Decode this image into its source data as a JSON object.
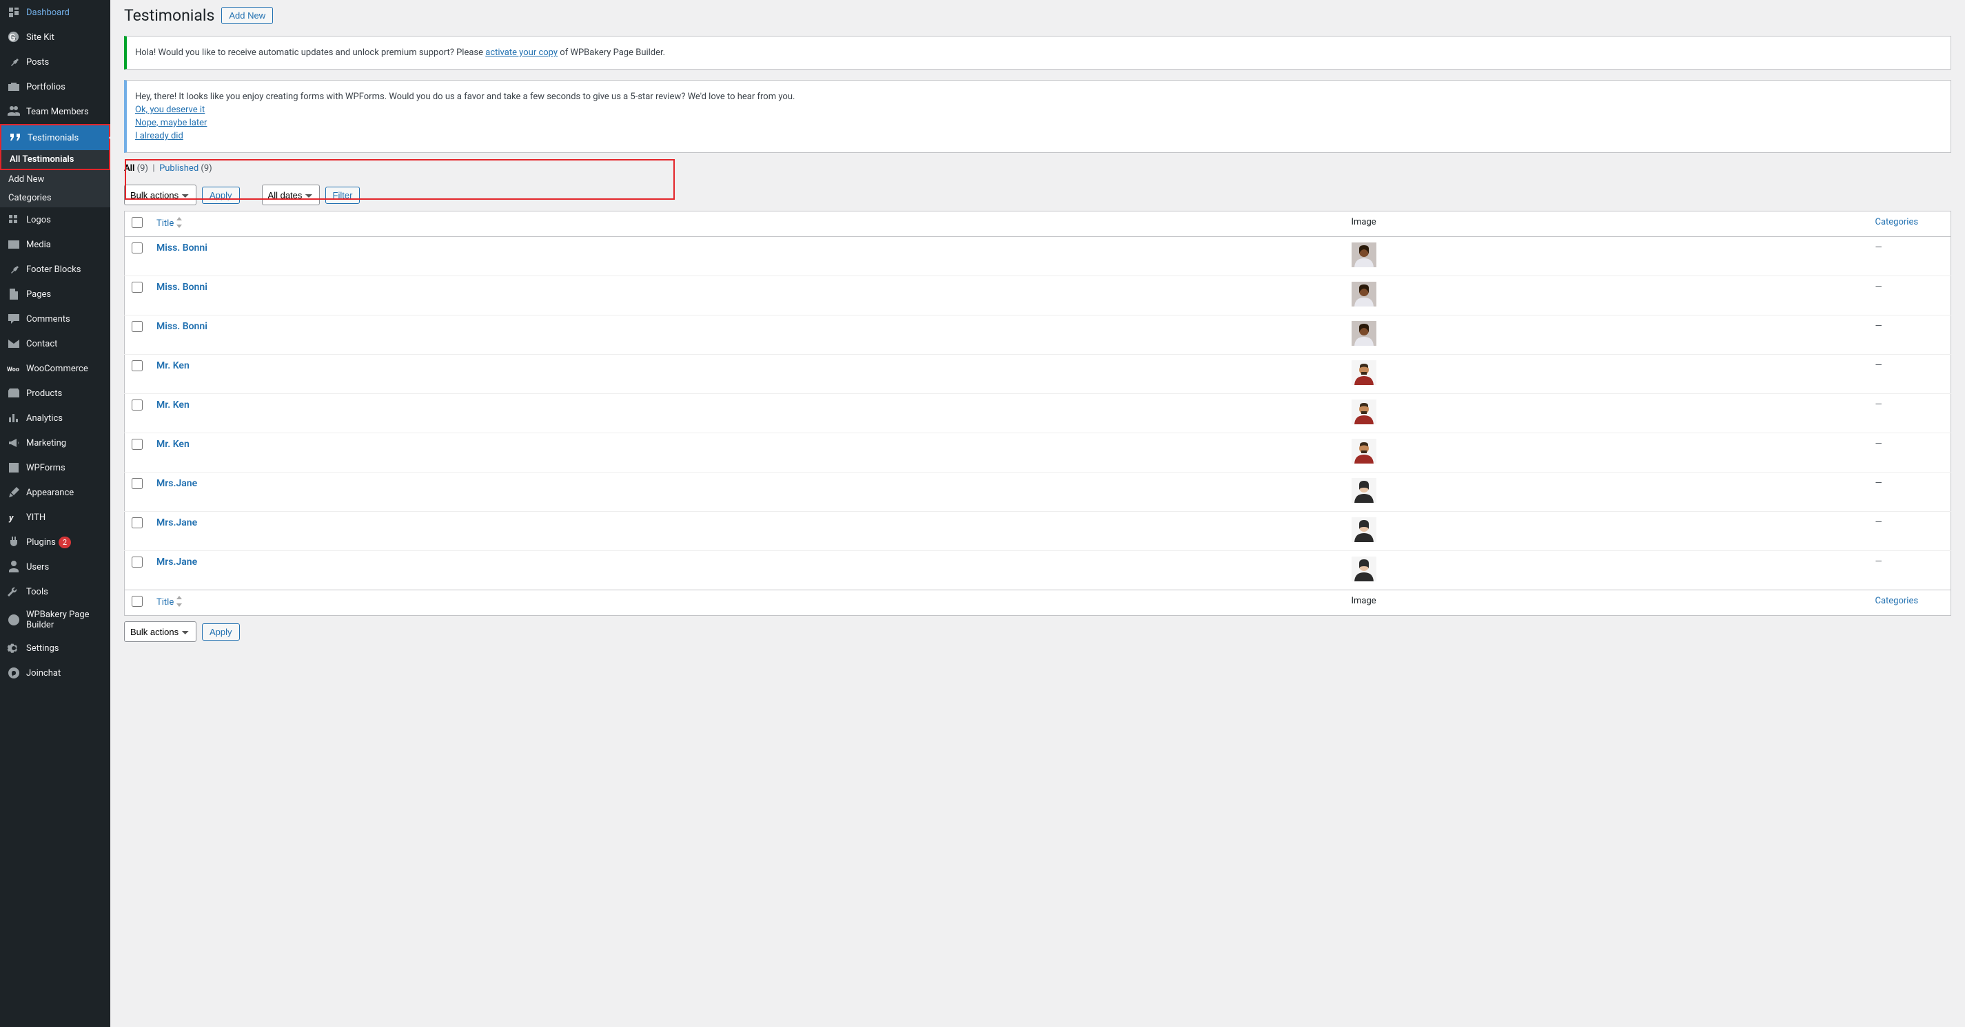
{
  "sidebar": {
    "items": [
      {
        "icon": "dashboard",
        "label": "Dashboard"
      },
      {
        "icon": "sitekit",
        "label": "Site Kit"
      },
      {
        "icon": "pin",
        "label": "Posts"
      },
      {
        "icon": "portfolio",
        "label": "Portfolios"
      },
      {
        "icon": "users",
        "label": "Team Members"
      },
      {
        "icon": "quote",
        "label": "Testimonials",
        "active": true
      },
      {
        "icon": "grid",
        "label": "Logos"
      },
      {
        "icon": "media",
        "label": "Media"
      },
      {
        "icon": "pin",
        "label": "Footer Blocks"
      },
      {
        "icon": "page",
        "label": "Pages"
      },
      {
        "icon": "comment",
        "label": "Comments"
      },
      {
        "icon": "mail",
        "label": "Contact"
      },
      {
        "icon": "woo",
        "label": "WooCommerce"
      },
      {
        "icon": "product",
        "label": "Products"
      },
      {
        "icon": "analytics",
        "label": "Analytics"
      },
      {
        "icon": "megaphone",
        "label": "Marketing"
      },
      {
        "icon": "form",
        "label": "WPForms"
      },
      {
        "icon": "brush",
        "label": "Appearance"
      },
      {
        "icon": "yith",
        "label": "YITH"
      },
      {
        "icon": "plugin",
        "label": "Plugins",
        "badge": "2"
      },
      {
        "icon": "user",
        "label": "Users"
      },
      {
        "icon": "wrench",
        "label": "Tools"
      },
      {
        "icon": "wpb",
        "label": "WPBakery Page Builder"
      },
      {
        "icon": "settings",
        "label": "Settings"
      },
      {
        "icon": "joinchat",
        "label": "Joinchat"
      }
    ],
    "submenu": [
      {
        "label": "All Testimonials",
        "active": true
      },
      {
        "label": "Add New"
      },
      {
        "label": "Categories"
      }
    ]
  },
  "header": {
    "title": "Testimonials",
    "add_new": "Add New"
  },
  "notices": {
    "wpbakery_pre": "Hola! Would you like to receive automatic updates and unlock premium support? Please ",
    "wpbakery_link": "activate your copy",
    "wpbakery_post": " of WPBakery Page Builder.",
    "wpforms_msg": "Hey, there! It looks like you enjoy creating forms with WPForms. Would you do us a favor and take a few seconds to give us a 5-star review? We'd love to hear from you.",
    "wpforms_ok": "Ok, you deserve it",
    "wpforms_later": "Nope, maybe later",
    "wpforms_did": "I already did"
  },
  "filters": {
    "all_label": "All",
    "all_count": "(9)",
    "separator": "|",
    "published_label": "Published",
    "published_count": "(9)",
    "bulk_actions": "Bulk actions",
    "apply": "Apply",
    "all_dates": "All dates",
    "filter": "Filter"
  },
  "table": {
    "title_header": "Title",
    "image_header": "Image",
    "categories_header": "Categories",
    "rows": [
      {
        "title": "Miss. Bonni",
        "img": "bonni",
        "cat": "—",
        "highlight": true
      },
      {
        "title": "Miss. Bonni",
        "img": "bonni",
        "cat": "—"
      },
      {
        "title": "Miss. Bonni",
        "img": "bonni",
        "cat": "—"
      },
      {
        "title": "Mr. Ken",
        "img": "ken",
        "cat": "—"
      },
      {
        "title": "Mr. Ken",
        "img": "ken",
        "cat": "—"
      },
      {
        "title": "Mr. Ken",
        "img": "ken",
        "cat": "—"
      },
      {
        "title": "Mrs.Jane",
        "img": "jane",
        "cat": "—"
      },
      {
        "title": "Mrs.Jane",
        "img": "jane",
        "cat": "—"
      },
      {
        "title": "Mrs.Jane",
        "img": "jane",
        "cat": "—"
      }
    ]
  },
  "avatars": {
    "bonni": {
      "bg": "#c9c2bf",
      "skin": "#7a4a2a",
      "top": "#e8e8ee"
    },
    "ken": {
      "bg": "#f5f5f5",
      "skin": "#c48a5a",
      "top": "#9e2b25"
    },
    "jane": {
      "bg": "#f5f5f5",
      "skin": "#e8c5a8",
      "top": "#2b2b2b"
    }
  }
}
